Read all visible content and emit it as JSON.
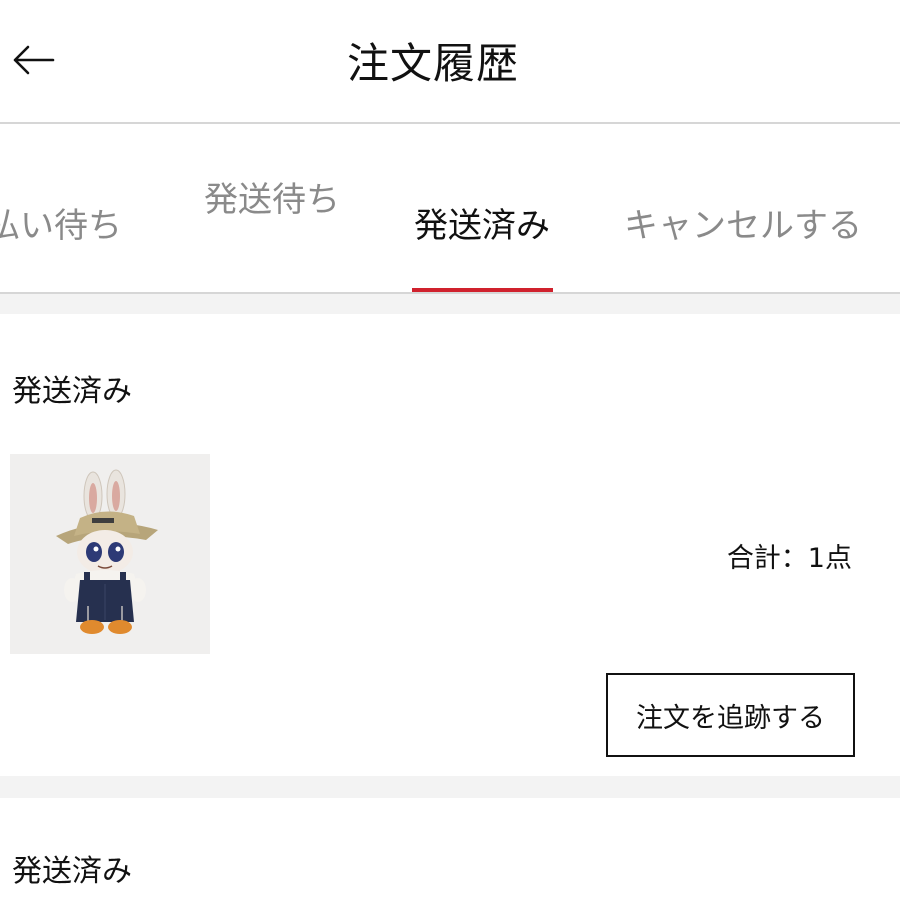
{
  "header": {
    "title": "注文履歴",
    "back_icon": "arrow-left-icon"
  },
  "tabs": [
    {
      "label": "払い待ち",
      "active": false
    },
    {
      "label": "発送待ち",
      "active": false
    },
    {
      "label": "発送済み",
      "active": true
    },
    {
      "label": "キャンセルする",
      "active": false
    }
  ],
  "colors": {
    "active_tab_underline": "#d0212d",
    "inactive_tab_text": "#8a8a8a",
    "section_divider": "#f3f3f3"
  },
  "orders": [
    {
      "status": "発送済み",
      "product_image": "labubu-figure-bucket-hat-overalls",
      "total": "合計：1点",
      "track_button": "注文を追跡する"
    },
    {
      "status": "発送済み"
    }
  ]
}
